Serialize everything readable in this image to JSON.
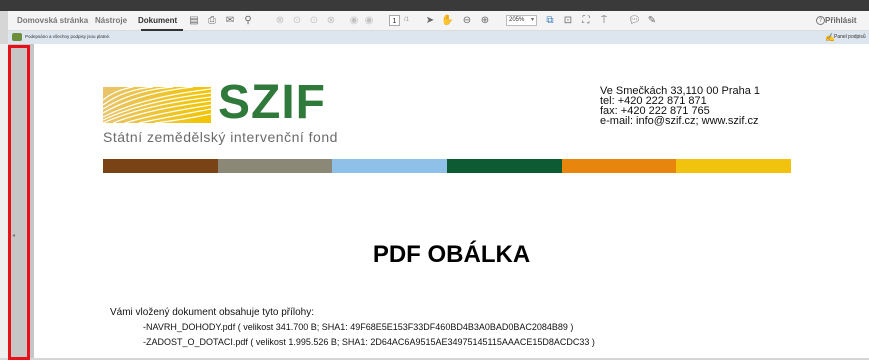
{
  "menu": {
    "home": "Domovská stránka",
    "tools": "Nástroje",
    "document": "Dokument",
    "login": "Přihlásit"
  },
  "toolbar": {
    "page_number": "1",
    "page_total": "/1",
    "zoom": "205%"
  },
  "infobar": {
    "text": "Podepsáno a všechny podpisy jsou platné.",
    "sign_label": "Panel podpisů"
  },
  "document": {
    "logo_text": "SZIF",
    "logo_subtitle": "Státní zemědělský intervenční fond",
    "contact": [
      "Ve Smečkách 33,110 00 Praha 1",
      "tel: +420 222 871 871",
      "fax: +420 222 871 765",
      "e-mail: info@szif.cz; www.szif.cz"
    ],
    "colors": [
      "#7a4316",
      "#8c8878",
      "#8fc0e8",
      "#0d5b32",
      "#e8850c",
      "#f2c30e"
    ],
    "title": "PDF OBÁLKA",
    "intro": "Vámi vložený dokument obsahuje tyto přílohy:",
    "attachments": [
      "-NAVRH_DOHODY.pdf ( velikost   341.700  B; SHA1: 49F68E5E153F33DF460BD4B3A0BAD0BAC2084B89 )",
      "-ZADOST_O_DOTACI.pdf ( velikost 1.995.526  B; SHA1: 2D64AC6A9515AE34975145115AAACE15D8ACDC33 )"
    ]
  }
}
